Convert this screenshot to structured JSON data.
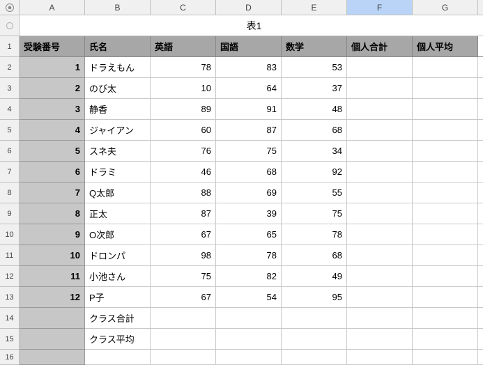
{
  "columns": [
    "A",
    "B",
    "C",
    "D",
    "E",
    "F",
    "G"
  ],
  "selectedColumn": "F",
  "title": "表1",
  "headers": {
    "exam_no": "受験番号",
    "name": "氏名",
    "english": "英語",
    "japanese": "国語",
    "math": "数学",
    "personal_total": "個人合計",
    "personal_avg": "個人平均"
  },
  "rows": [
    {
      "no": "1",
      "name": "ドラえもん",
      "eng": "78",
      "jpn": "83",
      "math": "53"
    },
    {
      "no": "2",
      "name": "のび太",
      "eng": "10",
      "jpn": "64",
      "math": "37"
    },
    {
      "no": "3",
      "name": "静香",
      "eng": "89",
      "jpn": "91",
      "math": "48"
    },
    {
      "no": "4",
      "name": "ジャイアン",
      "eng": "60",
      "jpn": "87",
      "math": "68"
    },
    {
      "no": "5",
      "name": "スネ夫",
      "eng": "76",
      "jpn": "75",
      "math": "34"
    },
    {
      "no": "6",
      "name": "ドラミ",
      "eng": "46",
      "jpn": "68",
      "math": "92"
    },
    {
      "no": "7",
      "name": "Q太郎",
      "eng": "88",
      "jpn": "69",
      "math": "55"
    },
    {
      "no": "8",
      "name": "正太",
      "eng": "87",
      "jpn": "39",
      "math": "75"
    },
    {
      "no": "9",
      "name": "O次郎",
      "eng": "67",
      "jpn": "65",
      "math": "78"
    },
    {
      "no": "10",
      "name": "ドロンパ",
      "eng": "98",
      "jpn": "78",
      "math": "68"
    },
    {
      "no": "11",
      "name": "小池さん",
      "eng": "75",
      "jpn": "82",
      "math": "49"
    },
    {
      "no": "12",
      "name": "P子",
      "eng": "67",
      "jpn": "54",
      "math": "95"
    }
  ],
  "summary": {
    "class_total": "クラス合計",
    "class_avg": "クラス平均"
  },
  "rowNumbers": [
    "1",
    "2",
    "3",
    "4",
    "5",
    "6",
    "7",
    "8",
    "9",
    "10",
    "11",
    "12",
    "13",
    "14",
    "15",
    "16"
  ]
}
